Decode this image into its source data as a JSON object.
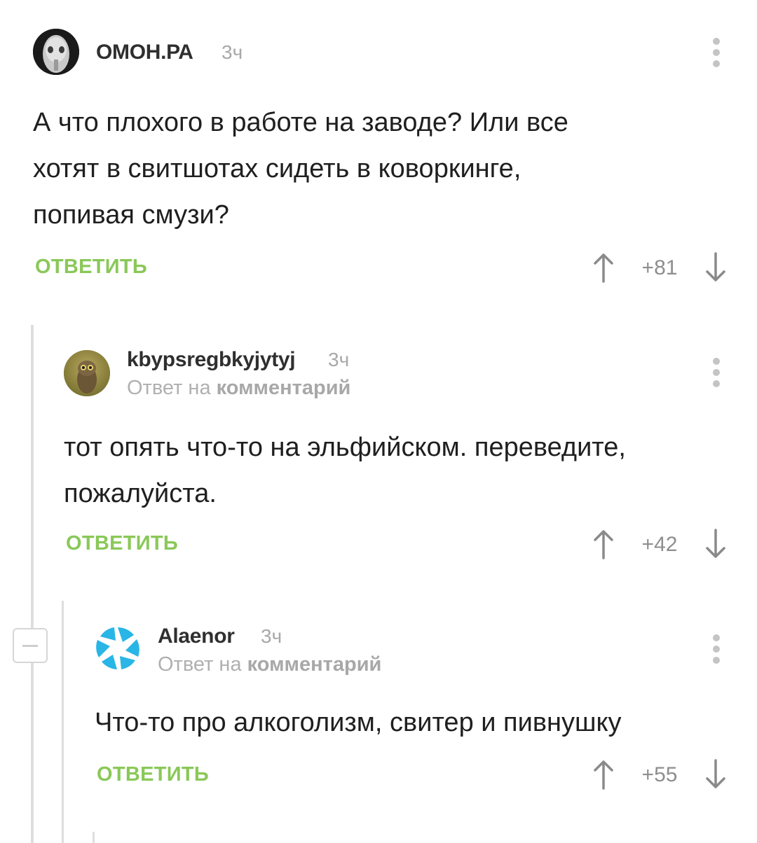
{
  "comments": [
    {
      "author": "ОМОН.РА",
      "time": "3ч",
      "text": [
        "А что плохого в работе на заводе? Или все",
        "хотят в свитшотах сидеть в коворкинге,",
        "попивая смузи?"
      ],
      "reply_label": "ОТВЕТИТЬ",
      "score": "+81",
      "avatar_icon": "alien-mask-avatar"
    },
    {
      "author": "kbypsregbkyjytyj",
      "time": "3ч",
      "reply_to_prefix": "Ответ на",
      "reply_to_link": "комментарий",
      "text": [
        "тот опять что-то на эльфийском. переведите,",
        "пожалуйста."
      ],
      "reply_label": "ОТВЕТИТЬ",
      "score": "+42",
      "avatar_icon": "owl-avatar"
    },
    {
      "author": "Alaenor",
      "time": "3ч",
      "reply_to_prefix": "Ответ на",
      "reply_to_link": "комментарий",
      "text": [
        "Что-то про алкоголизм, свитер и пивнушку"
      ],
      "reply_label": "ОТВЕТИТЬ",
      "score": "+55",
      "avatar_icon": "aperture-avatar"
    }
  ],
  "colors": {
    "accent_green": "#8ac858",
    "aperture_blue": "#29b6e6",
    "thread_line": "#dedede"
  }
}
